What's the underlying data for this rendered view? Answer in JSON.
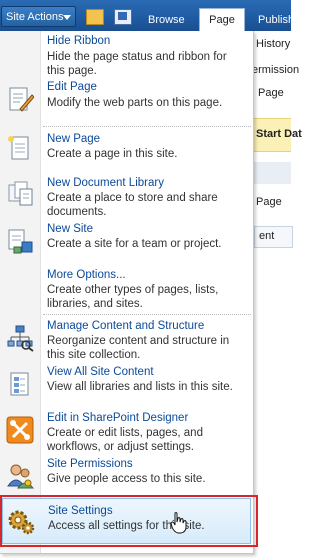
{
  "ribbon": {
    "site_actions_label": "Site Actions",
    "tabs": [
      {
        "label": "Browse"
      },
      {
        "label": "Page"
      },
      {
        "label": "Publish"
      }
    ]
  },
  "background": {
    "texts": [
      "History",
      "ermission",
      "Page",
      "Start Dat",
      "Page",
      "ent"
    ]
  },
  "menu": {
    "items": [
      {
        "title": "Hide Ribbon",
        "description": "Hide the page status and ribbon for this page.",
        "icon": "blank-icon"
      },
      {
        "title": "Edit Page",
        "description": "Modify the web parts on this page.",
        "icon": "edit-page-icon"
      },
      {
        "title": "New Page",
        "description": "Create a page in this site.",
        "icon": "new-page-icon"
      },
      {
        "title": "New Document Library",
        "description": "Create a place to store and share documents.",
        "icon": "document-library-icon"
      },
      {
        "title": "New Site",
        "description": "Create a site for a team or project.",
        "icon": "new-site-icon"
      },
      {
        "title": "More Options...",
        "description": "Create other types of pages, lists, libraries, and sites.",
        "icon": "blank-icon"
      },
      {
        "title": "Manage Content and Structure",
        "description": "Reorganize content and structure in this site collection.",
        "icon": "site-structure-icon"
      },
      {
        "title": "View All Site Content",
        "description": "View all libraries and lists in this site.",
        "icon": "site-content-icon"
      },
      {
        "title": "Edit in SharePoint Designer",
        "description": "Create or edit lists, pages, and workflows, or adjust settings.",
        "icon": "sharepoint-designer-icon"
      },
      {
        "title": "Site Permissions",
        "description": "Give people access to this site.",
        "icon": "permissions-icon"
      },
      {
        "title": "Site Settings",
        "description": "Access all settings for this site.",
        "icon": "gear-icon"
      }
    ]
  },
  "colors": {
    "ribbon_blue": "#1f5aa1",
    "link_blue": "#0b4a9a",
    "highlight_border": "#8fc0ea",
    "annotation_red": "#d7262c"
  }
}
